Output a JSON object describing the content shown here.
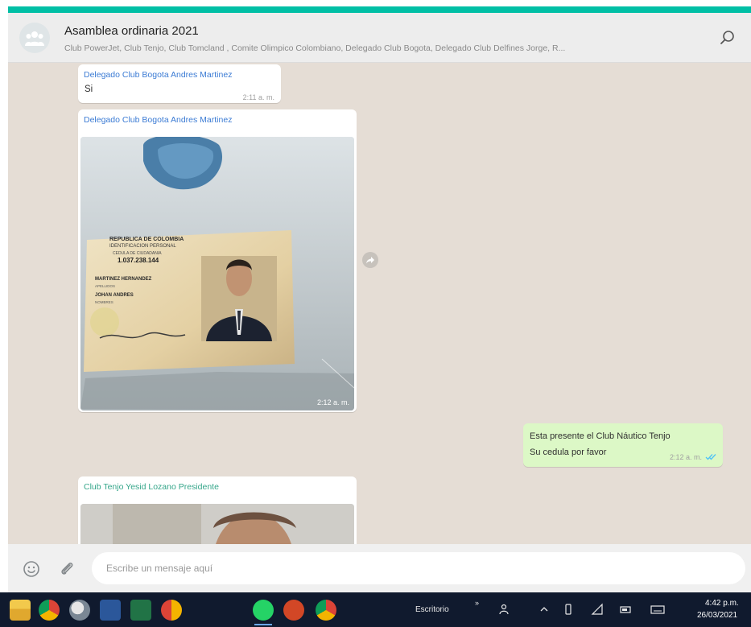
{
  "header": {
    "title": "Asamblea ordinaria 2021",
    "participants": "Club PowerJet, Club Tenjo, Club Tomcland , Comite Olimpico Colombiano, Delegado Club Bogota, Delegado Club Delfines Jorge, R...",
    "icons": {
      "avatar": "group-avatar-icon",
      "search": "search-icon"
    }
  },
  "messages": [
    {
      "sender": "Delegado Club Bogota Andres Martinez",
      "text": "Si",
      "time": "2:11 a. m."
    },
    {
      "sender": "Delegado Club Bogota Andres Martinez",
      "time": "2:12 a. m.",
      "image": {
        "card_lines": [
          "REPUBLICA DE COLOMBIA",
          "IDENTIFICACION PERSONAL",
          "CEDULA DE CIUDADANIA",
          "1.037.238.144",
          "MARTINEZ HERNANDEZ",
          "APELLIDOS",
          "JOHAN ANDRES",
          "NOMBRES"
        ]
      }
    },
    {
      "outgoing": true,
      "lines": [
        "Esta presente el Club Náutico Tenjo",
        "Su cedula por favor"
      ],
      "time": "2:12 a. m."
    },
    {
      "sender": "Club Tenjo Yesid Lozano Presidente"
    }
  ],
  "composer": {
    "placeholder": "Escribe un mensaje aquí",
    "icons": {
      "emoji": "emoji-icon",
      "attach": "paperclip-icon"
    }
  },
  "taskbar": {
    "apps": [
      "file-explorer-icon",
      "chrome-icon",
      "paint-icon",
      "word-icon",
      "excel-icon",
      "chrome-alt-icon",
      "whatsapp-icon",
      "powerpoint-icon",
      "chrome-profile-icon"
    ],
    "toolbar_label": "Escritorio",
    "time": "4:42 p.m.",
    "date": "26/03/2021"
  },
  "colors": {
    "accent": "#00bfa5",
    "outgoing_bubble": "#dcf8c6",
    "chat_bg": "#e5ddd5",
    "sender_blue": "#3b7bd4",
    "sender_teal": "#35a68a"
  }
}
